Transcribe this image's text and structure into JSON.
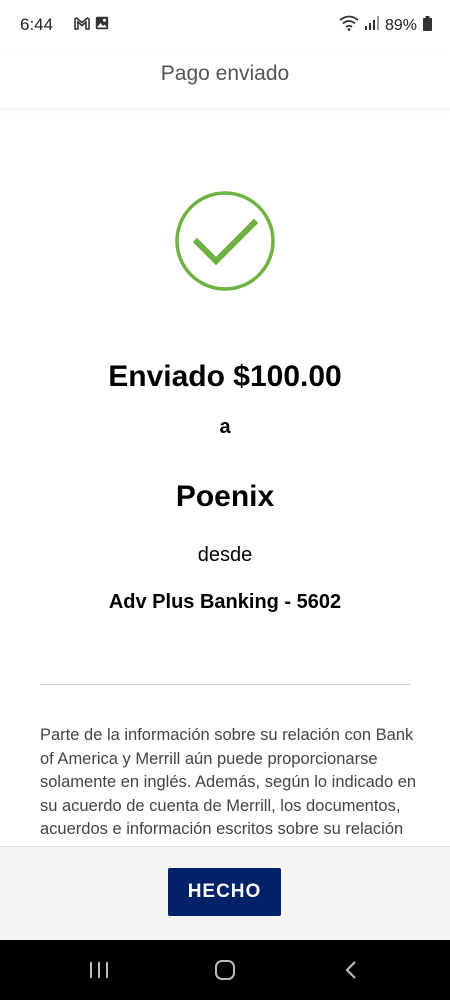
{
  "status_bar": {
    "time": "6:44",
    "battery": "89%",
    "icons": [
      "gmail-icon",
      "gallery-icon",
      "wifi-icon",
      "signal-icon",
      "battery-icon"
    ]
  },
  "header": {
    "title": "Pago enviado"
  },
  "confirmation": {
    "icon": "checkmark-circle-icon",
    "accent_color": "#6db33f",
    "amount_line": "Enviado $100.00",
    "to_word": "a",
    "recipient": "Poenix",
    "from_word": "desde",
    "account": "Adv Plus Banking - 5602"
  },
  "disclaimer": {
    "text": "Parte de la información sobre su relación con Bank of America y Merrill aún puede proporcionarse solamente en inglés. Además, según lo indicado en su acuerdo de cuenta de Merrill, los documentos, acuerdos e información escritos sobre su relación con"
  },
  "footer": {
    "done_label": "HECHO",
    "button_color": "#012169"
  },
  "nav": {
    "recents": "recents-icon",
    "home": "home-icon",
    "back": "back-icon"
  }
}
